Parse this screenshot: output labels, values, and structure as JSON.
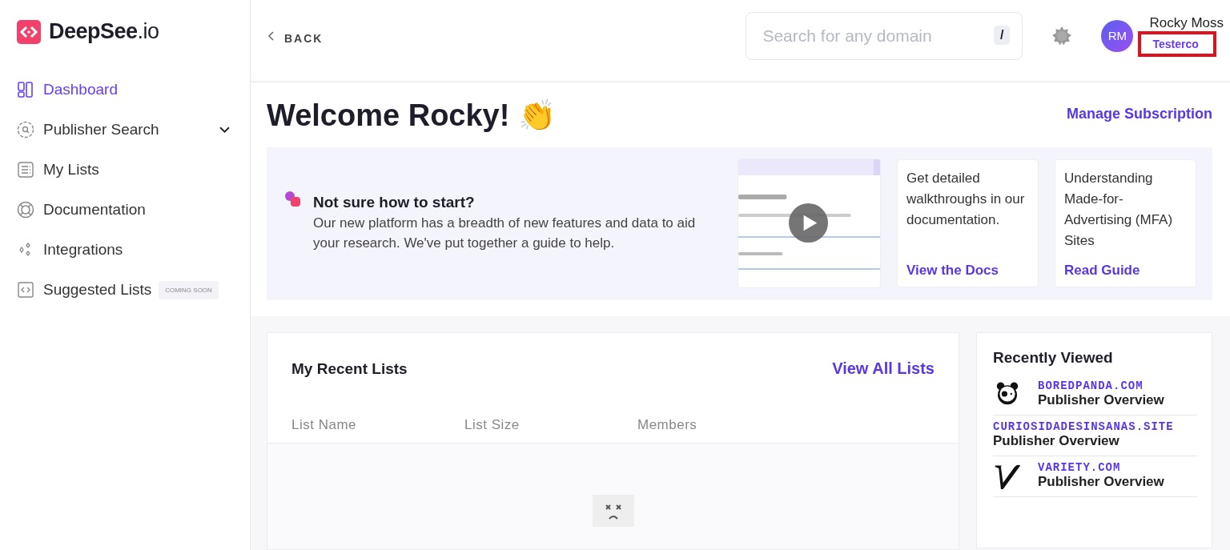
{
  "brand": {
    "name": "DeepSee",
    "suffix": ".io"
  },
  "sidebar": {
    "items": [
      {
        "label": "Dashboard",
        "kind": "dashboard",
        "selected": true
      },
      {
        "label": "Publisher Search",
        "kind": "search",
        "selected": false,
        "expanded": false
      },
      {
        "label": "My Lists",
        "kind": "list",
        "selected": false
      },
      {
        "label": "Documentation",
        "kind": "docs",
        "selected": false
      },
      {
        "label": "Integrations",
        "kind": "integrations",
        "selected": false
      },
      {
        "label": "Suggested Lists",
        "kind": "suggested",
        "selected": false,
        "badge": "COMING SOON"
      }
    ]
  },
  "header": {
    "back": "BACK",
    "search": {
      "placeholder": "Search for any domain",
      "shortcut": "/"
    },
    "user": {
      "initials": "RM",
      "name": "Rocky Moss",
      "organization": "Testerco",
      "highlighted": true
    }
  },
  "welcome": {
    "title": "Welcome Rocky! 👏",
    "action": "Manage Subscription"
  },
  "banner": {
    "title": "Not sure how to start?",
    "text": "Our new platform has a breadth of new features and data to aid your research. We've put together a guide to help.",
    "cards": [
      {
        "text": "Get detailed walkthroughs in our documentation.",
        "link": "View the Docs"
      },
      {
        "text": "Understanding Made-for-Advertising (MFA) Sites",
        "link": "Read Guide"
      }
    ]
  },
  "recent_lists": {
    "title": "My Recent Lists",
    "action": "View All Lists",
    "columns": [
      "List Name",
      "List Size",
      "Members"
    ]
  },
  "recently_viewed": {
    "title": "Recently Viewed",
    "items": [
      {
        "domain": "BOREDPANDA.COM",
        "subtitle": "Publisher Overview",
        "kind": "panda"
      },
      {
        "domain": "CURIOSIDADESINSANAS.SITE",
        "subtitle": "Publisher Overview",
        "kind": "plain"
      },
      {
        "domain": "VARIETY.COM",
        "subtitle": "Publisher Overview",
        "kind": "variety"
      }
    ]
  }
}
